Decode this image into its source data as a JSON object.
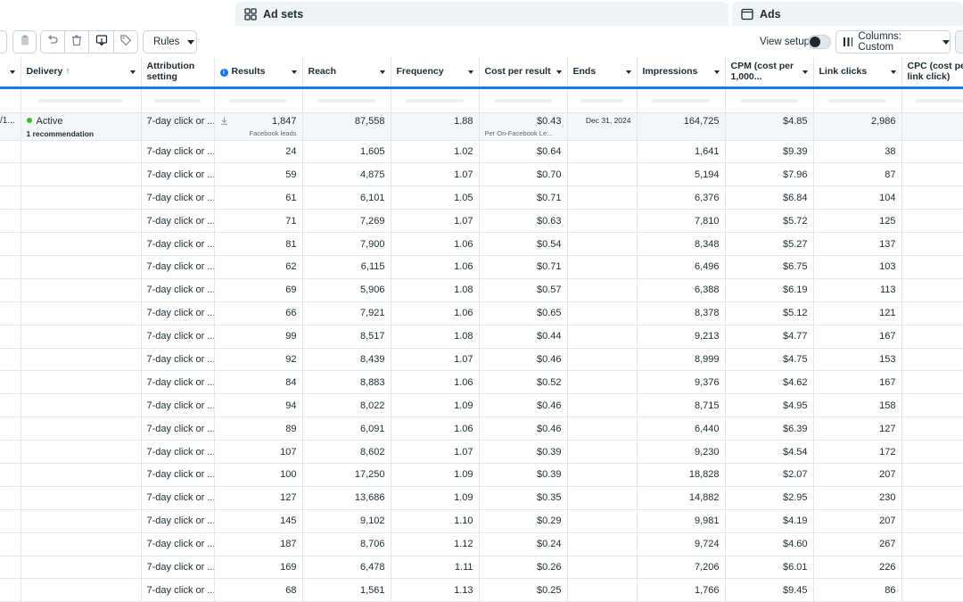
{
  "tabs": {
    "ad_sets": {
      "label": "Ad sets",
      "icon": "ad-sets-grid-icon"
    },
    "ads": {
      "label": "Ads",
      "icon": "ads-window-icon"
    }
  },
  "toolbar": {
    "rules_label": "Rules",
    "view_setup_label": "View setup",
    "columns_label": "Columns: Custom",
    "icons": [
      "duplicate-icon",
      "undo-icon",
      "delete-icon",
      "export-icon",
      "tag-icon"
    ]
  },
  "table": {
    "headers": {
      "name": "",
      "delivery": "Delivery",
      "delivery_sort_arrow": "↑",
      "attribution": "Attribution setting",
      "results": "Results",
      "reach": "Reach",
      "frequency": "Frequency",
      "cost_per_result": "Cost per result",
      "ends": "Ends",
      "impressions": "Impressions",
      "cpm": "CPM (cost per 1,000...",
      "link_clicks": "Link clicks",
      "cpc": "CPC (cost per link click)"
    },
    "summary": {
      "name_fragment": "/1...",
      "delivery": "Active",
      "recommendation": "1 recommendation",
      "attribution": "7-day click or ...",
      "results": "1,847",
      "results_sub": "Facebook leads",
      "reach": "87,558",
      "frequency": "1.88",
      "cost_per_result": "$0.43",
      "cost_per_result_sub": "Per On-Facebook Le...",
      "ends": "Dec 31, 2024",
      "impressions": "164,725",
      "cpm": "$4.85",
      "link_clicks": "2,986"
    },
    "rows": [
      {
        "attribution": "7-day click or ...",
        "results": "24",
        "reach": "1,605",
        "frequency": "1.02",
        "cost_per_result": "$0.64",
        "impressions": "1,641",
        "cpm": "$9.39",
        "link_clicks": "38"
      },
      {
        "attribution": "7-day click or ...",
        "results": "59",
        "reach": "4,875",
        "frequency": "1.07",
        "cost_per_result": "$0.70",
        "impressions": "5,194",
        "cpm": "$7.96",
        "link_clicks": "87"
      },
      {
        "attribution": "7-day click or ...",
        "results": "61",
        "reach": "6,101",
        "frequency": "1.05",
        "cost_per_result": "$0.71",
        "impressions": "6,376",
        "cpm": "$6.84",
        "link_clicks": "104"
      },
      {
        "attribution": "7-day click or ...",
        "results": "71",
        "reach": "7,269",
        "frequency": "1.07",
        "cost_per_result": "$0.63",
        "impressions": "7,810",
        "cpm": "$5.72",
        "link_clicks": "125"
      },
      {
        "attribution": "7-day click or ...",
        "results": "81",
        "reach": "7,900",
        "frequency": "1.06",
        "cost_per_result": "$0.54",
        "impressions": "8,348",
        "cpm": "$5.27",
        "link_clicks": "137"
      },
      {
        "attribution": "7-day click or ...",
        "results": "62",
        "reach": "6,115",
        "frequency": "1.06",
        "cost_per_result": "$0.71",
        "impressions": "6,496",
        "cpm": "$6.75",
        "link_clicks": "103"
      },
      {
        "attribution": "7-day click or ...",
        "results": "69",
        "reach": "5,906",
        "frequency": "1.08",
        "cost_per_result": "$0.57",
        "impressions": "6,388",
        "cpm": "$6.19",
        "link_clicks": "113"
      },
      {
        "attribution": "7-day click or ...",
        "results": "66",
        "reach": "7,921",
        "frequency": "1.06",
        "cost_per_result": "$0.65",
        "impressions": "8,378",
        "cpm": "$5.12",
        "link_clicks": "121"
      },
      {
        "attribution": "7-day click or ...",
        "results": "99",
        "reach": "8,517",
        "frequency": "1.08",
        "cost_per_result": "$0.44",
        "impressions": "9,213",
        "cpm": "$4.77",
        "link_clicks": "167"
      },
      {
        "attribution": "7-day click or ...",
        "results": "92",
        "reach": "8,439",
        "frequency": "1.07",
        "cost_per_result": "$0.46",
        "impressions": "8,999",
        "cpm": "$4.75",
        "link_clicks": "153"
      },
      {
        "attribution": "7-day click or ...",
        "results": "84",
        "reach": "8,883",
        "frequency": "1.06",
        "cost_per_result": "$0.52",
        "impressions": "9,376",
        "cpm": "$4.62",
        "link_clicks": "167"
      },
      {
        "attribution": "7-day click or ...",
        "results": "94",
        "reach": "8,022",
        "frequency": "1.09",
        "cost_per_result": "$0.46",
        "impressions": "8,715",
        "cpm": "$4.95",
        "link_clicks": "158"
      },
      {
        "attribution": "7-day click or ...",
        "results": "89",
        "reach": "6,091",
        "frequency": "1.06",
        "cost_per_result": "$0.46",
        "impressions": "6,440",
        "cpm": "$6.39",
        "link_clicks": "127"
      },
      {
        "attribution": "7-day click or ...",
        "results": "107",
        "reach": "8,602",
        "frequency": "1.07",
        "cost_per_result": "$0.39",
        "impressions": "9,230",
        "cpm": "$4.54",
        "link_clicks": "172"
      },
      {
        "attribution": "7-day click or ...",
        "results": "100",
        "reach": "17,250",
        "frequency": "1.09",
        "cost_per_result": "$0.39",
        "impressions": "18,828",
        "cpm": "$2.07",
        "link_clicks": "207"
      },
      {
        "attribution": "7-day click or ...",
        "results": "127",
        "reach": "13,686",
        "frequency": "1.09",
        "cost_per_result": "$0.35",
        "impressions": "14,882",
        "cpm": "$2.95",
        "link_clicks": "230"
      },
      {
        "attribution": "7-day click or ...",
        "results": "145",
        "reach": "9,102",
        "frequency": "1.10",
        "cost_per_result": "$0.29",
        "impressions": "9,981",
        "cpm": "$4.19",
        "link_clicks": "207"
      },
      {
        "attribution": "7-day click or ...",
        "results": "187",
        "reach": "8,706",
        "frequency": "1.12",
        "cost_per_result": "$0.24",
        "impressions": "9,724",
        "cpm": "$4.60",
        "link_clicks": "267"
      },
      {
        "attribution": "7-day click or ...",
        "results": "169",
        "reach": "6,478",
        "frequency": "1.11",
        "cost_per_result": "$0.26",
        "impressions": "7,206",
        "cpm": "$6.01",
        "link_clicks": "226"
      },
      {
        "attribution": "7-day click or ...",
        "results": "68",
        "reach": "1,561",
        "frequency": "1.13",
        "cost_per_result": "$0.25",
        "impressions": "1,766",
        "cpm": "$9.45",
        "link_clicks": "86"
      }
    ]
  },
  "colors": {
    "accent": "#1877f2",
    "active_dot": "#42b72a",
    "summary_bg": "#f5f6f7"
  }
}
